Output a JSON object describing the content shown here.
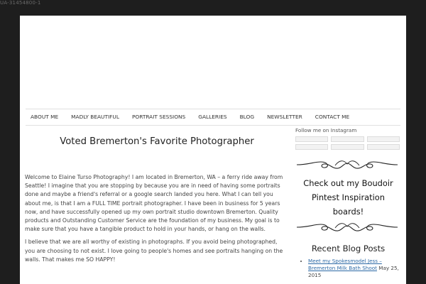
{
  "tracking_code": "UA-31454800-1",
  "nav": {
    "items": [
      "ABOUT ME",
      "MADLY BEAUTIFUL",
      "PORTRAIT SESSIONS",
      "GALLERIES",
      "BLOG",
      "NEWSLETTER",
      "CONTACT ME"
    ]
  },
  "main": {
    "title": "Voted Bremerton's Favorite Photographer",
    "paragraphs": [
      "Welcome to Elaine Turso Photography! I am located in Bremerton, WA –  a ferry ride away from Seattle! I imagine that you are stopping by because you are in need of having some portraits done and maybe a friend's referral or a google search landed you here. What I can tell you about me, is that I am a FULL TIME portrait photographer. I have been in business for 5 years now, and have successfully opened up my own portrait studio downtown Bremerton.  Quality products and Outstanding Customer Service are the foundation of my business. My goal is to make sure that you have a tangible product to hold in your hands, or hang on the walls.",
      "I believe that we are all worthy of existing in photographs. If you avoid being photographed, you are choosing to not exist. I love going to people's homes and see portraits hanging on the walls. That makes me SO HAPPY!"
    ]
  },
  "sidebar": {
    "follow_text": "Follow me on Instagram",
    "check_out": "Check out my Boudoir Pintest Inspiration boards!",
    "recent_title": "Recent Blog Posts",
    "posts": [
      {
        "title": "Meet my Spokesmodel Jess – Bremerton Milk Bath Shoot",
        "date": "May 25, 2015"
      }
    ]
  },
  "colors": {
    "background": "#1e1e1e",
    "page": "#ffffff",
    "link": "#2d6aa6"
  }
}
